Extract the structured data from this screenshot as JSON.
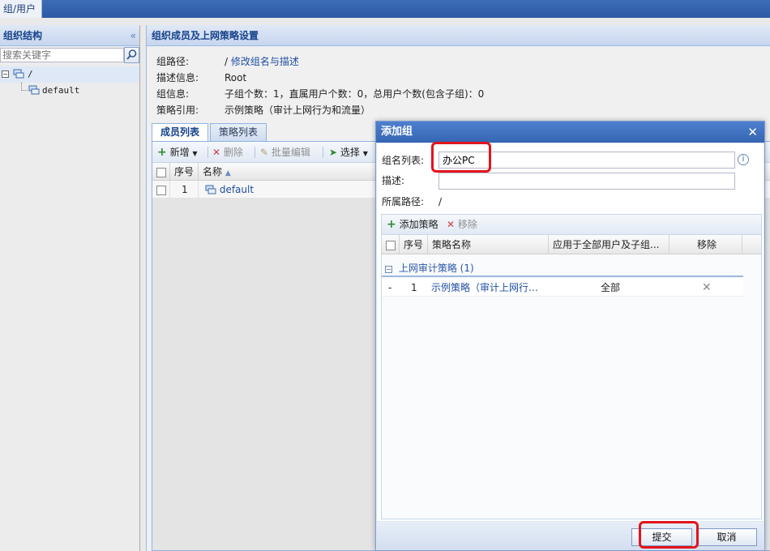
{
  "top": {
    "tab_label": "组/用户"
  },
  "left": {
    "title": "组织结构",
    "collapse_glyph": "«",
    "search_placeholder": "搜索关键字",
    "tree": {
      "root_label": "/",
      "child_label": "default"
    }
  },
  "right": {
    "title": "组织成员及上网策略设置",
    "info": [
      {
        "label": "组路径:",
        "value": "/",
        "link": "修改组名与描述"
      },
      {
        "label": "描述信息:",
        "value": "Root"
      },
      {
        "label": "组信息:",
        "value": "子组个数：1，直属用户个数：0，总用户个数(包含子组)：0"
      },
      {
        "label": "策略引用:",
        "value": "示例策略（审计上网行为和流量）"
      }
    ],
    "tabs": [
      "成员列表",
      "策略列表"
    ],
    "toolbar": {
      "add": "新增",
      "delete": "删除",
      "batch_edit": "批量编辑",
      "select": "选择"
    },
    "grid": {
      "columns": [
        "序号",
        "名称"
      ],
      "rows": [
        {
          "index": "1",
          "name": "default"
        }
      ]
    }
  },
  "dialog": {
    "title": "添加组",
    "close_glyph": "✕",
    "fields": {
      "group_list_label": "组名列表:",
      "group_list_value": "办公PC",
      "description_label": "描述:",
      "description_value": "",
      "path_label": "所属路径:",
      "path_value": "/"
    },
    "policy_toolbar": {
      "add": "添加策略",
      "remove": "移除"
    },
    "policy_columns": [
      "序号",
      "策略名称",
      "应用于全部用户及子组...",
      "移除"
    ],
    "policy_group": "上网审计策略 (1)",
    "policy_rows": [
      {
        "dash": "-",
        "index": "1",
        "name": "示例策略（审计上网行…",
        "scope": "全部"
      }
    ],
    "buttons": {
      "submit": "提交",
      "cancel": "取消"
    }
  },
  "colors": {
    "accent": "#15428b",
    "link": "#1f4ea3",
    "highlight": "#e3141b",
    "add_green": "#2e8b2e",
    "delete_red": "#d23a3a"
  }
}
